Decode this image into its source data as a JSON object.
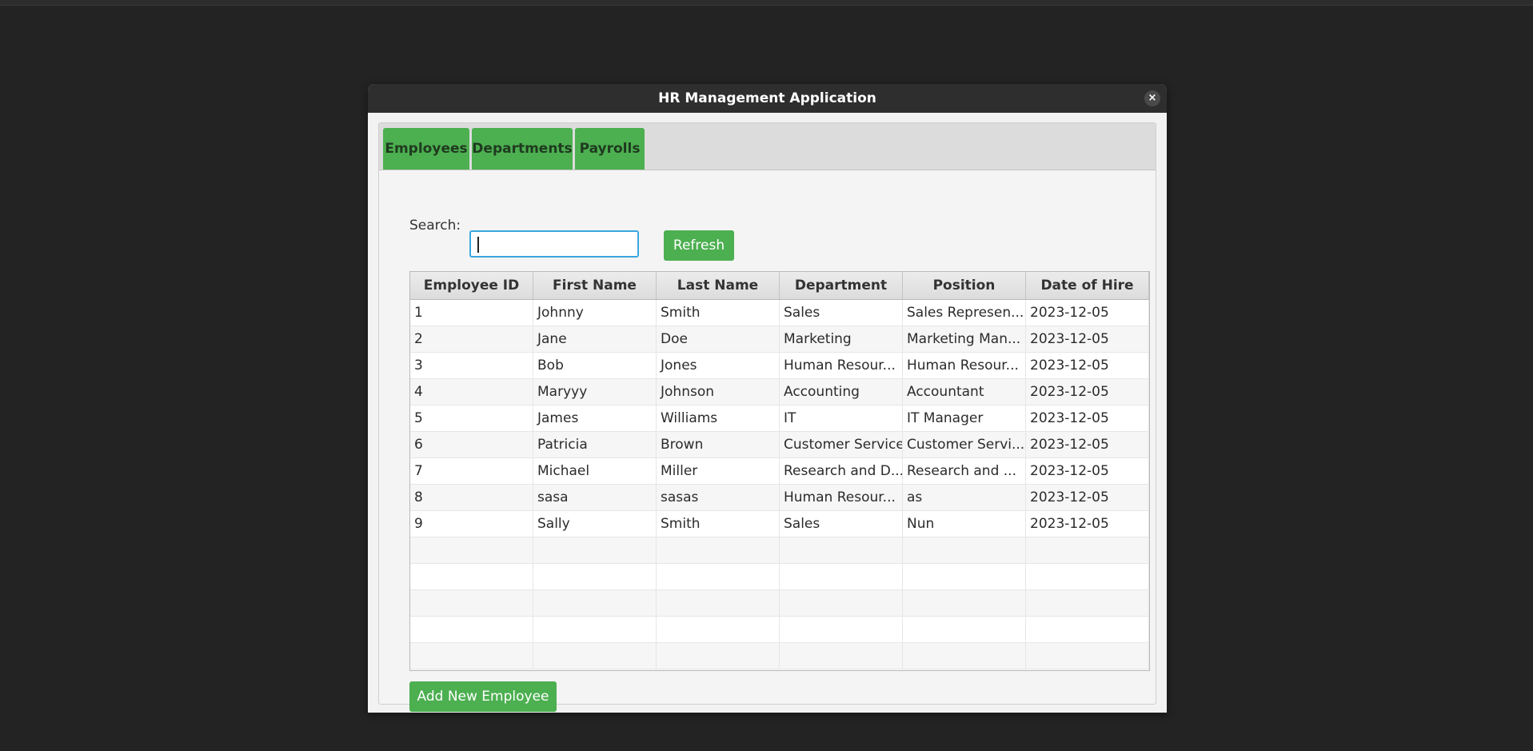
{
  "window": {
    "title": "HR Management Application",
    "close_glyph": "×"
  },
  "tabs": [
    {
      "label": "Employees",
      "selected": true
    },
    {
      "label": "Departments",
      "selected": false
    },
    {
      "label": "Payrolls",
      "selected": false
    }
  ],
  "search": {
    "label": "Search:",
    "value": "",
    "placeholder": ""
  },
  "refresh_label": "Refresh",
  "table": {
    "columns": [
      "Employee ID",
      "First Name",
      "Last Name",
      "Department",
      "Position",
      "Date of Hire"
    ],
    "rows": [
      [
        "1",
        "Johnny",
        "Smith",
        "Sales",
        "Sales Represen...",
        "2023-12-05"
      ],
      [
        "2",
        "Jane",
        "Doe",
        "Marketing",
        "Marketing Man...",
        "2023-12-05"
      ],
      [
        "3",
        "Bob",
        "Jones",
        "Human Resour...",
        "Human Resour...",
        "2023-12-05"
      ],
      [
        "4",
        "Maryyy",
        "Johnson",
        "Accounting",
        "Accountant",
        "2023-12-05"
      ],
      [
        "5",
        "James",
        "Williams",
        "IT",
        "IT Manager",
        "2023-12-05"
      ],
      [
        "6",
        "Patricia",
        "Brown",
        "Customer Service",
        "Customer Servi...",
        "2023-12-05"
      ],
      [
        "7",
        "Michael",
        "Miller",
        "Research and D...",
        "Research and ...",
        "2023-12-05"
      ],
      [
        "8",
        "sasa",
        "sasas",
        "Human Resour...",
        "as",
        "2023-12-05"
      ],
      [
        "9",
        "Sally",
        "Smith",
        "Sales",
        "Nun",
        "2023-12-05"
      ]
    ],
    "empty_rows": 5
  },
  "add_button_label": "Add New Employee",
  "colors": {
    "accent": "#4caf50",
    "tab_text": "#1f3a1f",
    "focus_border": "#39a7e0",
    "desktop_bg": "#232323",
    "titlebar_bg": "#2e2e2e"
  }
}
